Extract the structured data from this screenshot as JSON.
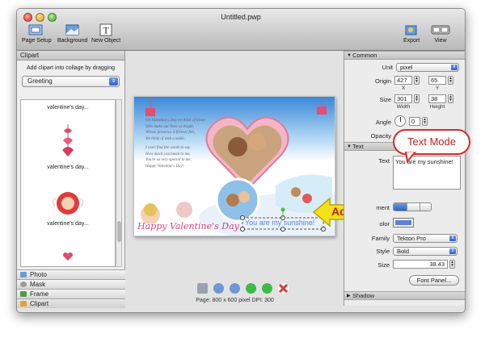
{
  "window": {
    "title": "Untitled.pwp"
  },
  "toolbar": {
    "page_setup": "Page Setup",
    "background": "Background",
    "new_object": "New Object",
    "export": "Export",
    "view": "View"
  },
  "sidebar": {
    "header": "Clipart",
    "hint": "Add clipart into collage by dragging",
    "category": "Greeting",
    "items": [
      {
        "label": "valentine's day..."
      },
      {
        "label": "valentine's day..."
      },
      {
        "label": "valentine's day..."
      }
    ],
    "tabs": [
      {
        "label": "Photo",
        "icon": "photo-icon"
      },
      {
        "label": "Mask",
        "icon": "mask-icon"
      },
      {
        "label": "Frame",
        "icon": "frame-icon"
      },
      {
        "label": "Clipart",
        "icon": "clipart-icon"
      }
    ]
  },
  "canvas": {
    "card_text_lines": [
      "On Valentine's Day we think of those",
      "Who make our lives so bright,",
      "Whose presence is forever felt,",
      "We think of with a smile.",
      "I can't find the words to say",
      "How much you mean to me,",
      "You're so very special to me,",
      "Happy Valentine's Day!"
    ],
    "card_caption": "Happy Valentine's Day",
    "selected_text": "You are my sunshine!",
    "status": "Page: 800 x 600 pixel DPI: 300"
  },
  "inspector": {
    "common": {
      "header": "Common",
      "unit_label": "Unit",
      "unit_value": "pixel",
      "origin_label": "Origin",
      "origin_x": "427",
      "origin_y": "65",
      "x_label": "X",
      "y_label": "Y",
      "size_label": "Size",
      "width": "301",
      "height": "38",
      "width_label": "Width",
      "height_label": "Height",
      "angle_label": "Angle",
      "angle_value": "0",
      "opacity_label": "Opacity"
    },
    "text": {
      "header": "Text",
      "text_label": "Text",
      "text_value": "You are my sunshine!",
      "alignment_label": "ment",
      "color_label": "olor",
      "color_value": "#5b7fdc",
      "family_label": "Family",
      "family_value": "Tekton Pro",
      "style_label": "Style",
      "style_value": "Bold",
      "size_label": "Size",
      "size_value": "38.43",
      "font_panel": "Font Panel..."
    },
    "shadow": {
      "header": "Shadow"
    }
  },
  "annotations": {
    "add": "Add",
    "text_mode": "Text Mode"
  },
  "colors": {
    "callout_yellow": "#f3e21a",
    "callout_red": "#d32b2b",
    "accent_blue": "#2c63c6"
  }
}
